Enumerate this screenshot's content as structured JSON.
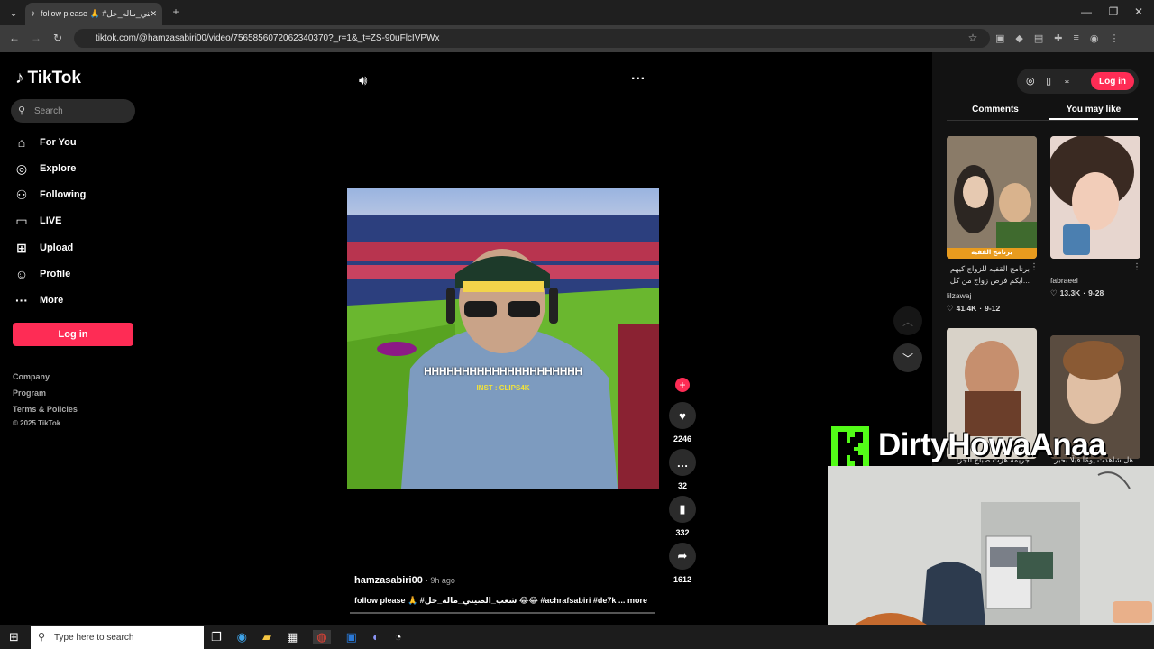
{
  "browser": {
    "tab_title": "follow please 🙏 #شعب_الصيني_ماله_حل",
    "url": "tiktok.com/@hamzasabiri00/video/7565856072062340370?_r=1&_t=ZS-90uFlcIVPWx"
  },
  "sidebar": {
    "logo": "TikTok",
    "search_placeholder": "Search",
    "nav": [
      {
        "label": "For You",
        "icon": "home-icon"
      },
      {
        "label": "Explore",
        "icon": "compass-icon"
      },
      {
        "label": "Following",
        "icon": "user-follow-icon"
      },
      {
        "label": "LIVE",
        "icon": "live-icon"
      },
      {
        "label": "Upload",
        "icon": "upload-icon"
      },
      {
        "label": "Profile",
        "icon": "profile-icon"
      },
      {
        "label": "More",
        "icon": "more-icon"
      }
    ],
    "login": "Log in",
    "footer": [
      "Company",
      "Program",
      "Terms & Policies",
      "© 2025 TikTok"
    ]
  },
  "video": {
    "caption_overlay": "HHHHHHHHHHHHHHHHHHHHH",
    "watermark": "INST : CLIPS4K",
    "author": "hamzasabiri00",
    "time": "· 9h ago",
    "description": "follow please 🙏 #شعب_الصيني_ماله_حل 😂😂 #achrafsabiri #de7k ...",
    "more": "more",
    "stats": {
      "likes": "2246",
      "comments": "32",
      "saves": "332",
      "shares": "1612"
    }
  },
  "right": {
    "login": "Log in",
    "tabs": [
      "Comments",
      "You may like"
    ],
    "cards": [
      {
        "title": "برنامج القفيه للزواج كيهم ...ايكم فرص زواج من كل",
        "user": "lilzawaj",
        "likes": "41.4K",
        "date": "9-12",
        "thumb_text": "برنامج القفيه"
      },
      {
        "title": "",
        "user": "fabraeel",
        "likes": "13.3K",
        "date": "9-28"
      },
      {
        "title": "جريمة هزت صباح الجزا",
        "user": "",
        "likes": "",
        "date": ""
      },
      {
        "title": "هل شاهدت يومًا قبلًا بحبر",
        "user": "",
        "likes": "",
        "date": ""
      }
    ]
  },
  "overlay": {
    "channel": "DirtyHowaAnaa",
    "badge": "x19"
  },
  "taskbar": {
    "search": "Type here to search"
  },
  "colors": {
    "accent": "#fe2c55",
    "kick": "#53fc18"
  }
}
